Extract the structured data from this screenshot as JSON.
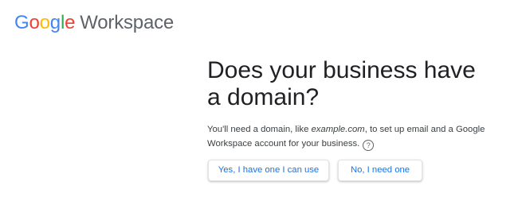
{
  "logo": {
    "letters": [
      "G",
      "o",
      "o",
      "g",
      "l",
      "e"
    ],
    "product": "Workspace",
    "colors": {
      "blue": "#4285F4",
      "red": "#EA4335",
      "yellow": "#FBBC05",
      "green": "#34A853",
      "product": "#5f6368"
    }
  },
  "main": {
    "heading": "Does your business have a domain?",
    "description": {
      "part1": "You'll need a domain, like ",
      "example": "example.com",
      "part2": ", to set up email and a Google Workspace account for your business.",
      "help_icon": "help-circle-icon",
      "help_glyph": "?"
    },
    "buttons": {
      "yes_label": "Yes, I have one I can use",
      "no_label": "No, I need one"
    },
    "accent_color": "#1a73e8"
  }
}
